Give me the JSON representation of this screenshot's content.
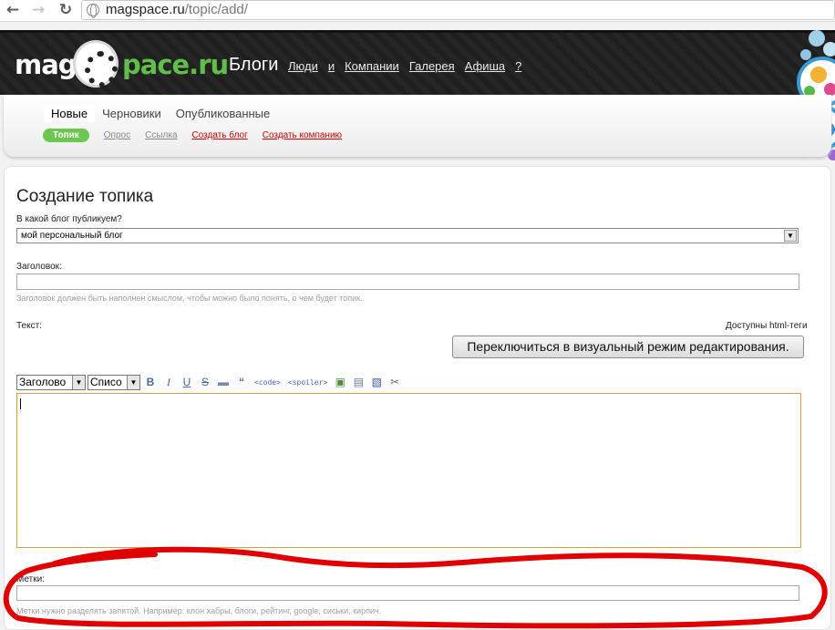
{
  "browser": {
    "url_host": "magspace.ru",
    "url_path": "/topic/add/"
  },
  "header": {
    "logo_prefix": "mag",
    "logo_suffix": "pace.ru",
    "main_nav": "Блоги",
    "links": [
      "Люди",
      "и",
      "Компании",
      "Галерея",
      "Афиша",
      "?"
    ]
  },
  "subnav": {
    "tabs": [
      {
        "label": "Новые",
        "active": true
      },
      {
        "label": "Черновики",
        "active": false
      },
      {
        "label": "Опубликованные",
        "active": false
      }
    ],
    "pill_active": "Топик",
    "pill_links": [
      "Опрос",
      "Ссылка"
    ],
    "pill_red": [
      "Создать блог",
      "Создать компанию"
    ]
  },
  "form": {
    "title": "Создание топика",
    "blog_label": "В какой блог публикуем?",
    "blog_value": "мой персональный блог",
    "heading_label": "Заголовок:",
    "heading_hint": "Заголовок должен быть наполнен смыслом, чтобы можно было понять, о чем будет топик.",
    "text_label": "Текст:",
    "html_tags_note": "Доступны html-теги",
    "visual_button": "Переключиться в визуальный режим редактирования.",
    "toolbar": {
      "heading_select": "Заголово",
      "list_select": "Списо",
      "code_tag": "<code>",
      "spoiler_tag": "<spoiler>"
    },
    "tags_label": "Метки:",
    "tags_hint": "Метки нужно разделять запятой. Например: клон хабры, блоги, рейтинг, google, сиськи, кирпич."
  },
  "colors": {
    "accent_green": "#6dc64f",
    "link_red": "#cc0000",
    "annotation_red": "#e00000",
    "textarea_border": "#d3a23c"
  }
}
